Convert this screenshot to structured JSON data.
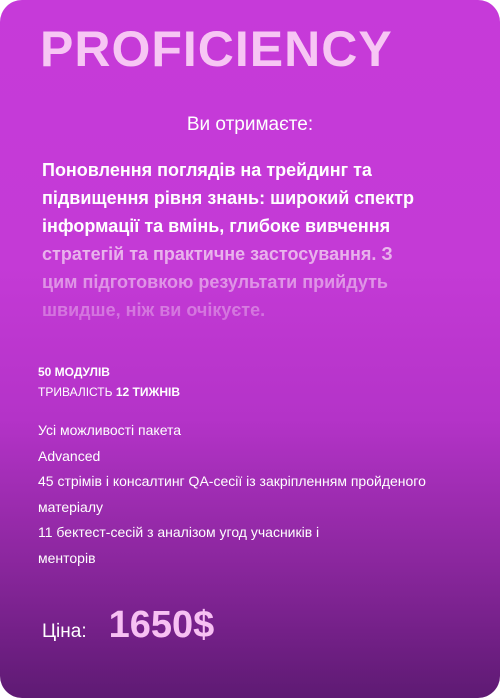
{
  "card": {
    "title": "PROFICIENCY",
    "subtitle": "Ви отримаєте:",
    "description_lines": [
      "Поновлення поглядів на трейдинг та",
      "підвищення рівня знань: широкий спектр",
      "інформації та вмінь, глибоке вивчення",
      "стратегій та практичне застосування. З",
      "цим підготовкою результати прийдуть",
      "швидше, ніж ви очікуєте."
    ],
    "modules": "50 МОДУЛІВ",
    "duration_label": "ТРИВАЛІСТЬ ",
    "duration_value": "12 ТИЖНІВ",
    "feature_lines": [
      "Усі можливості пакета",
      "Advanced",
      "45 стрімів і консалтинг QA-сесії із закріпленням пройденого",
      "матеріалу",
      "11 бектест-сесій з аналізом угод учасників і",
      "менторів"
    ],
    "price_label": "Ціна:",
    "price_value": "1650$"
  },
  "colors": {
    "gradient_top": "#c63ad9",
    "gradient_bottom": "#5e1a73",
    "title": "#f7c6f4",
    "price": "#f7c0f3"
  }
}
